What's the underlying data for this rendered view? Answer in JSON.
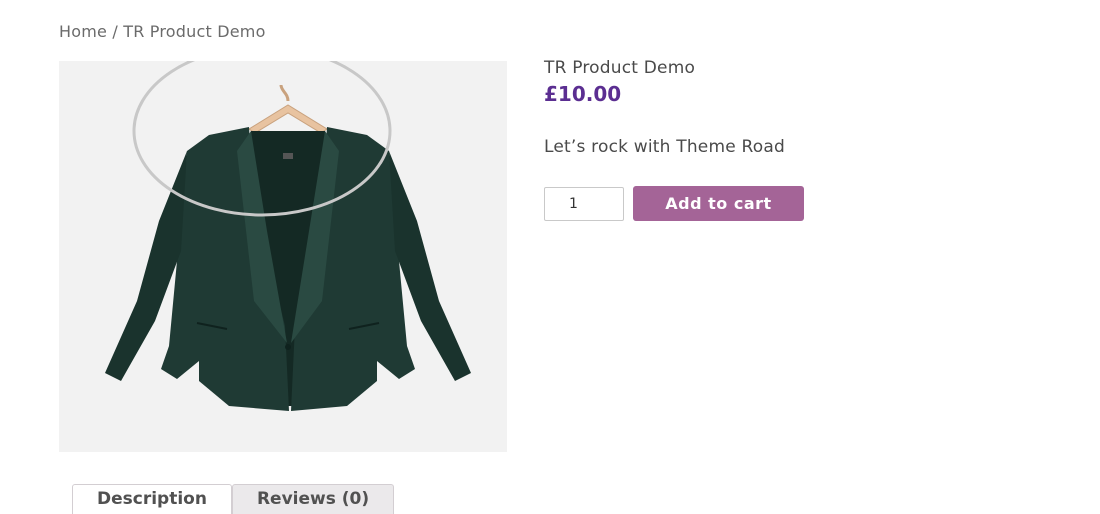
{
  "breadcrumb": {
    "home": "Home",
    "separator": " / ",
    "current": "TR Product Demo"
  },
  "product": {
    "title": "TR Product Demo",
    "price": "£10.00",
    "short_description": "Let’s rock with Theme Road",
    "image_icon": "jacket-on-hanger-image"
  },
  "cart": {
    "quantity": "1",
    "add_to_cart_label": "Add to cart"
  },
  "tabs": [
    {
      "label": "Description",
      "active": true
    },
    {
      "label": "Reviews (0)",
      "active": false
    }
  ],
  "colors": {
    "price": "#5b2e91",
    "button": "#a46497",
    "jacket": "#1f3a34"
  }
}
